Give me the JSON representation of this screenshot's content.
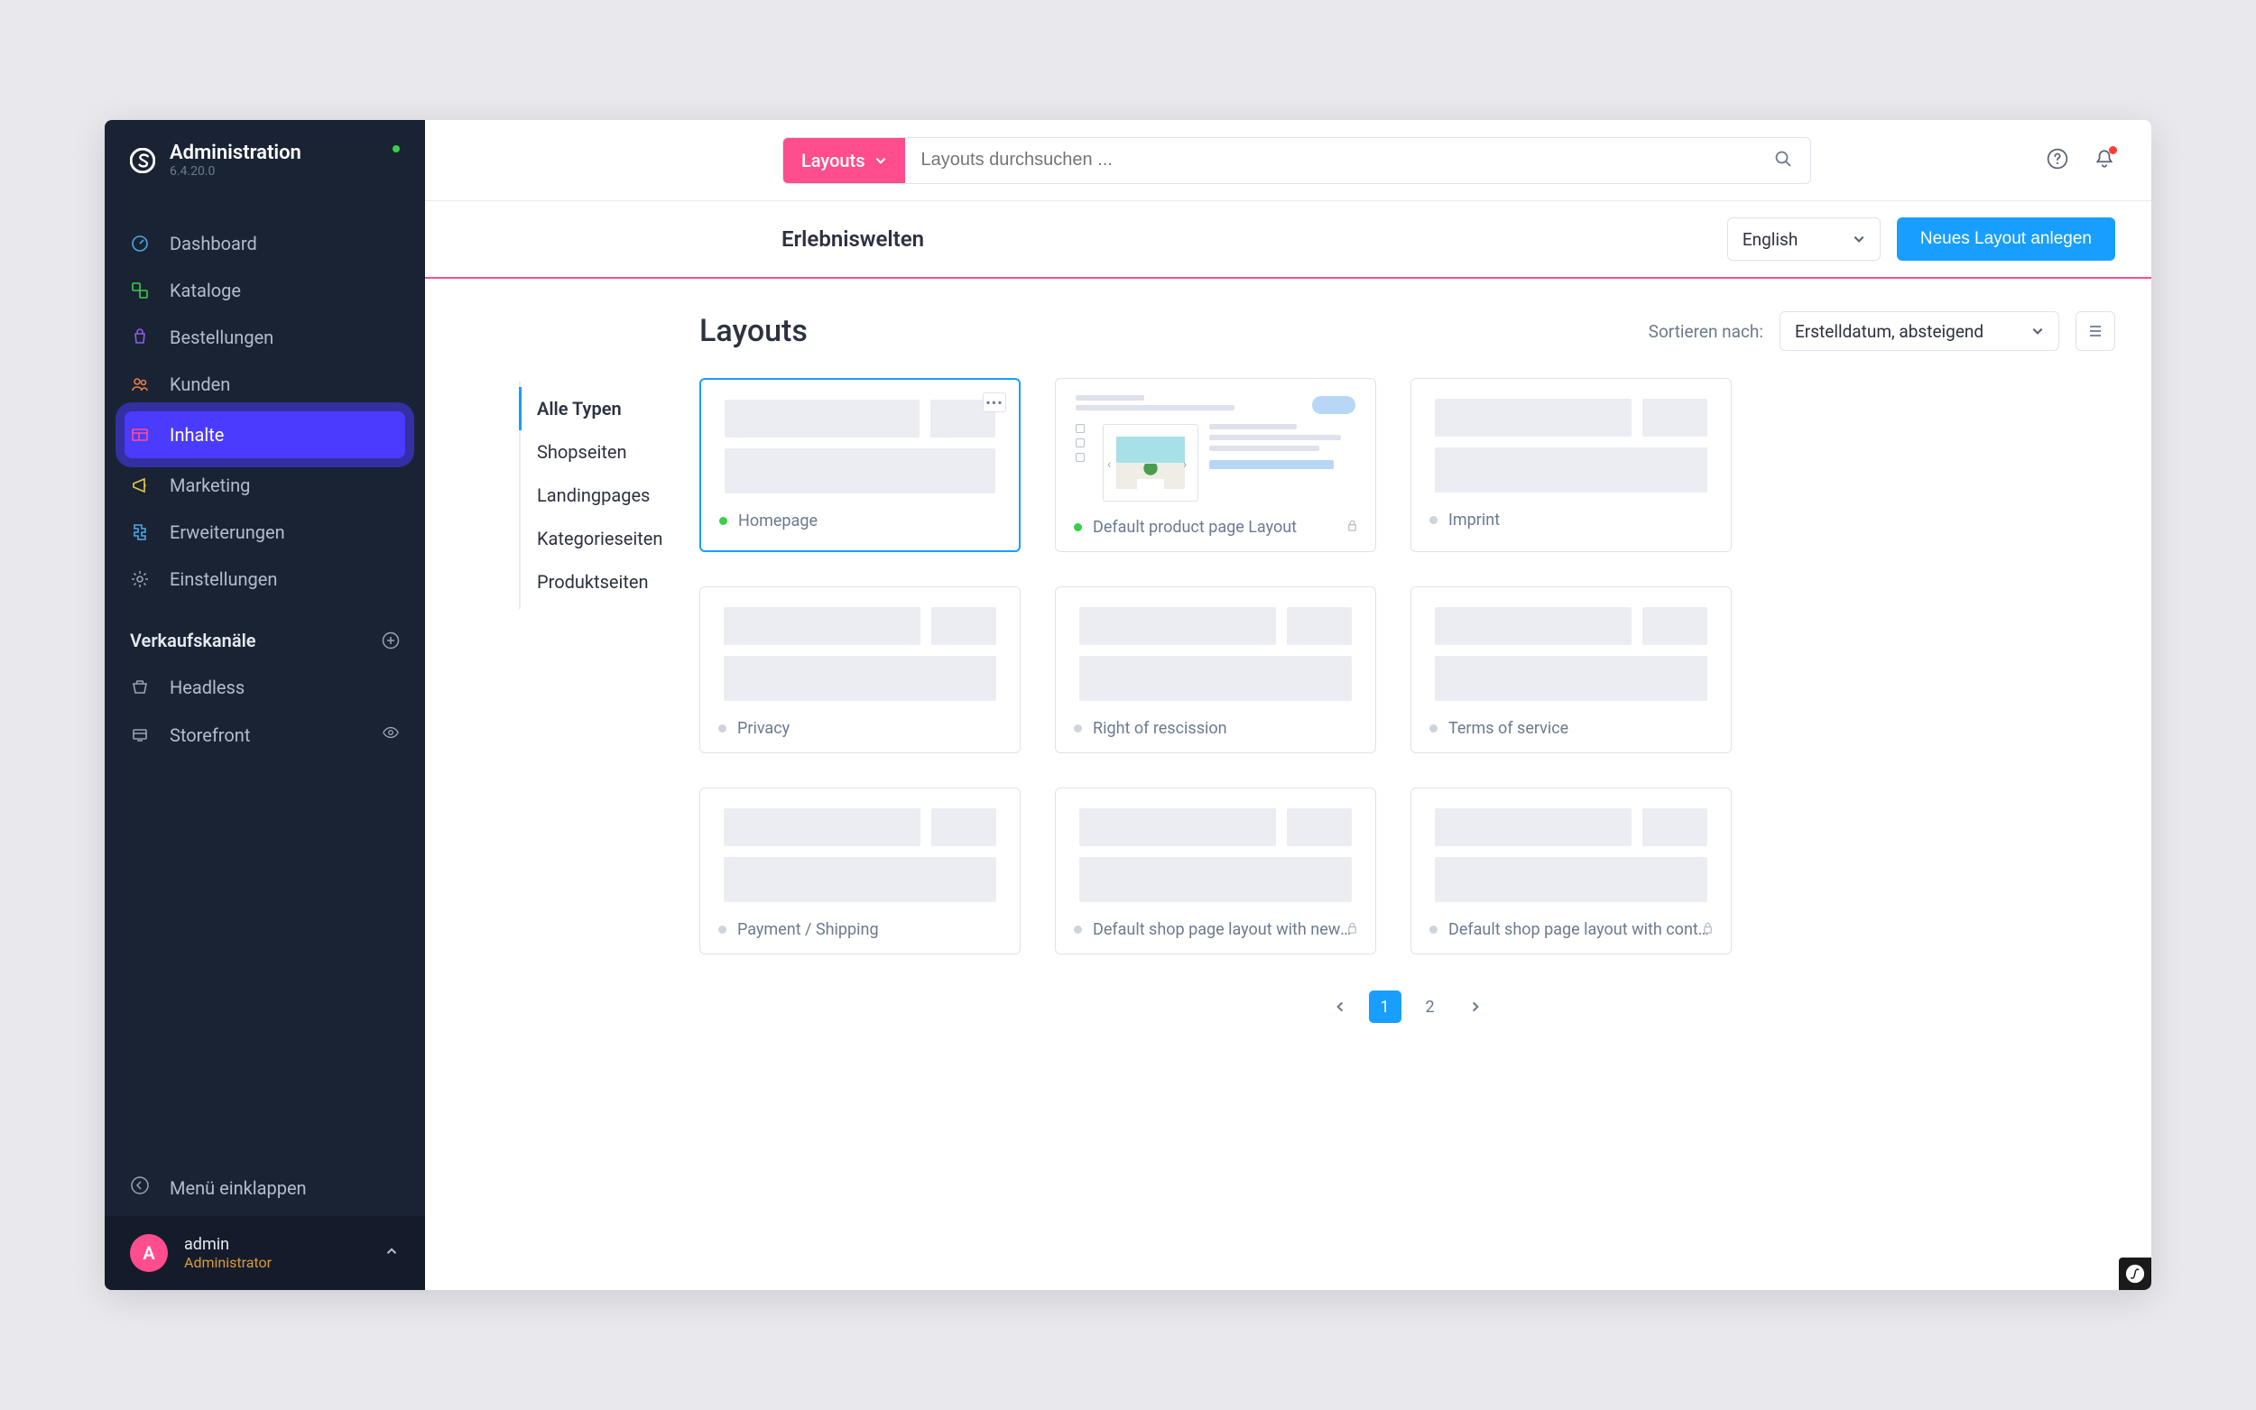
{
  "header": {
    "title": "Administration",
    "version": "6.4.20.0"
  },
  "nav": [
    {
      "key": "dashboard",
      "label": "Dashboard",
      "color": "#4aa9e8"
    },
    {
      "key": "catalogs",
      "label": "Kataloge",
      "color": "#37d046"
    },
    {
      "key": "orders",
      "label": "Bestellungen",
      "color": "#8a5fe8"
    },
    {
      "key": "customers",
      "label": "Kunden",
      "color": "#e87a4a"
    },
    {
      "key": "content",
      "label": "Inhalte",
      "color": "#ff4d8d",
      "highlighted": true
    },
    {
      "key": "marketing",
      "label": "Marketing",
      "color": "#e8c84a"
    },
    {
      "key": "extensions",
      "label": "Erweiterungen",
      "color": "#4aa9e8"
    },
    {
      "key": "settings",
      "label": "Einstellungen",
      "color": "#9aa3b5"
    }
  ],
  "sales_channels": {
    "heading": "Verkaufskanäle",
    "items": [
      {
        "key": "headless",
        "label": "Headless"
      },
      {
        "key": "storefront",
        "label": "Storefront",
        "has_eye": true
      }
    ]
  },
  "collapse_label": "Menü einklappen",
  "user": {
    "initial": "A",
    "name": "admin",
    "role": "Administrator"
  },
  "search": {
    "scope": "Layouts",
    "placeholder": "Layouts durchsuchen ..."
  },
  "page": {
    "title": "Erlebniswelten",
    "language": "English",
    "new_button": "Neues Layout anlegen"
  },
  "listing": {
    "title": "Layouts",
    "sort_label": "Sortieren nach:",
    "sort_value": "Erstelldatum, absteigend"
  },
  "type_tabs": [
    "Alle Typen",
    "Shopseiten",
    "Landingpages",
    "Kategorieseiten",
    "Produktseiten"
  ],
  "layouts": [
    {
      "name": "Homepage",
      "active": true,
      "selected": true,
      "context": true,
      "kind": "generic"
    },
    {
      "name": "Default product page Layout",
      "active": true,
      "locked": true,
      "kind": "product"
    },
    {
      "name": "Imprint",
      "active": false,
      "kind": "generic"
    },
    {
      "name": "Privacy",
      "active": false,
      "kind": "generic"
    },
    {
      "name": "Right of rescission",
      "active": false,
      "kind": "generic"
    },
    {
      "name": "Terms of service",
      "active": false,
      "kind": "generic"
    },
    {
      "name": "Payment / Shipping",
      "active": false,
      "kind": "generic"
    },
    {
      "name": "Default shop page layout with newsle…",
      "active": false,
      "locked": true,
      "kind": "generic"
    },
    {
      "name": "Default shop page layout with contac…",
      "active": false,
      "locked": true,
      "kind": "generic"
    }
  ],
  "pagination": {
    "current": 1,
    "pages": [
      1,
      2
    ]
  }
}
